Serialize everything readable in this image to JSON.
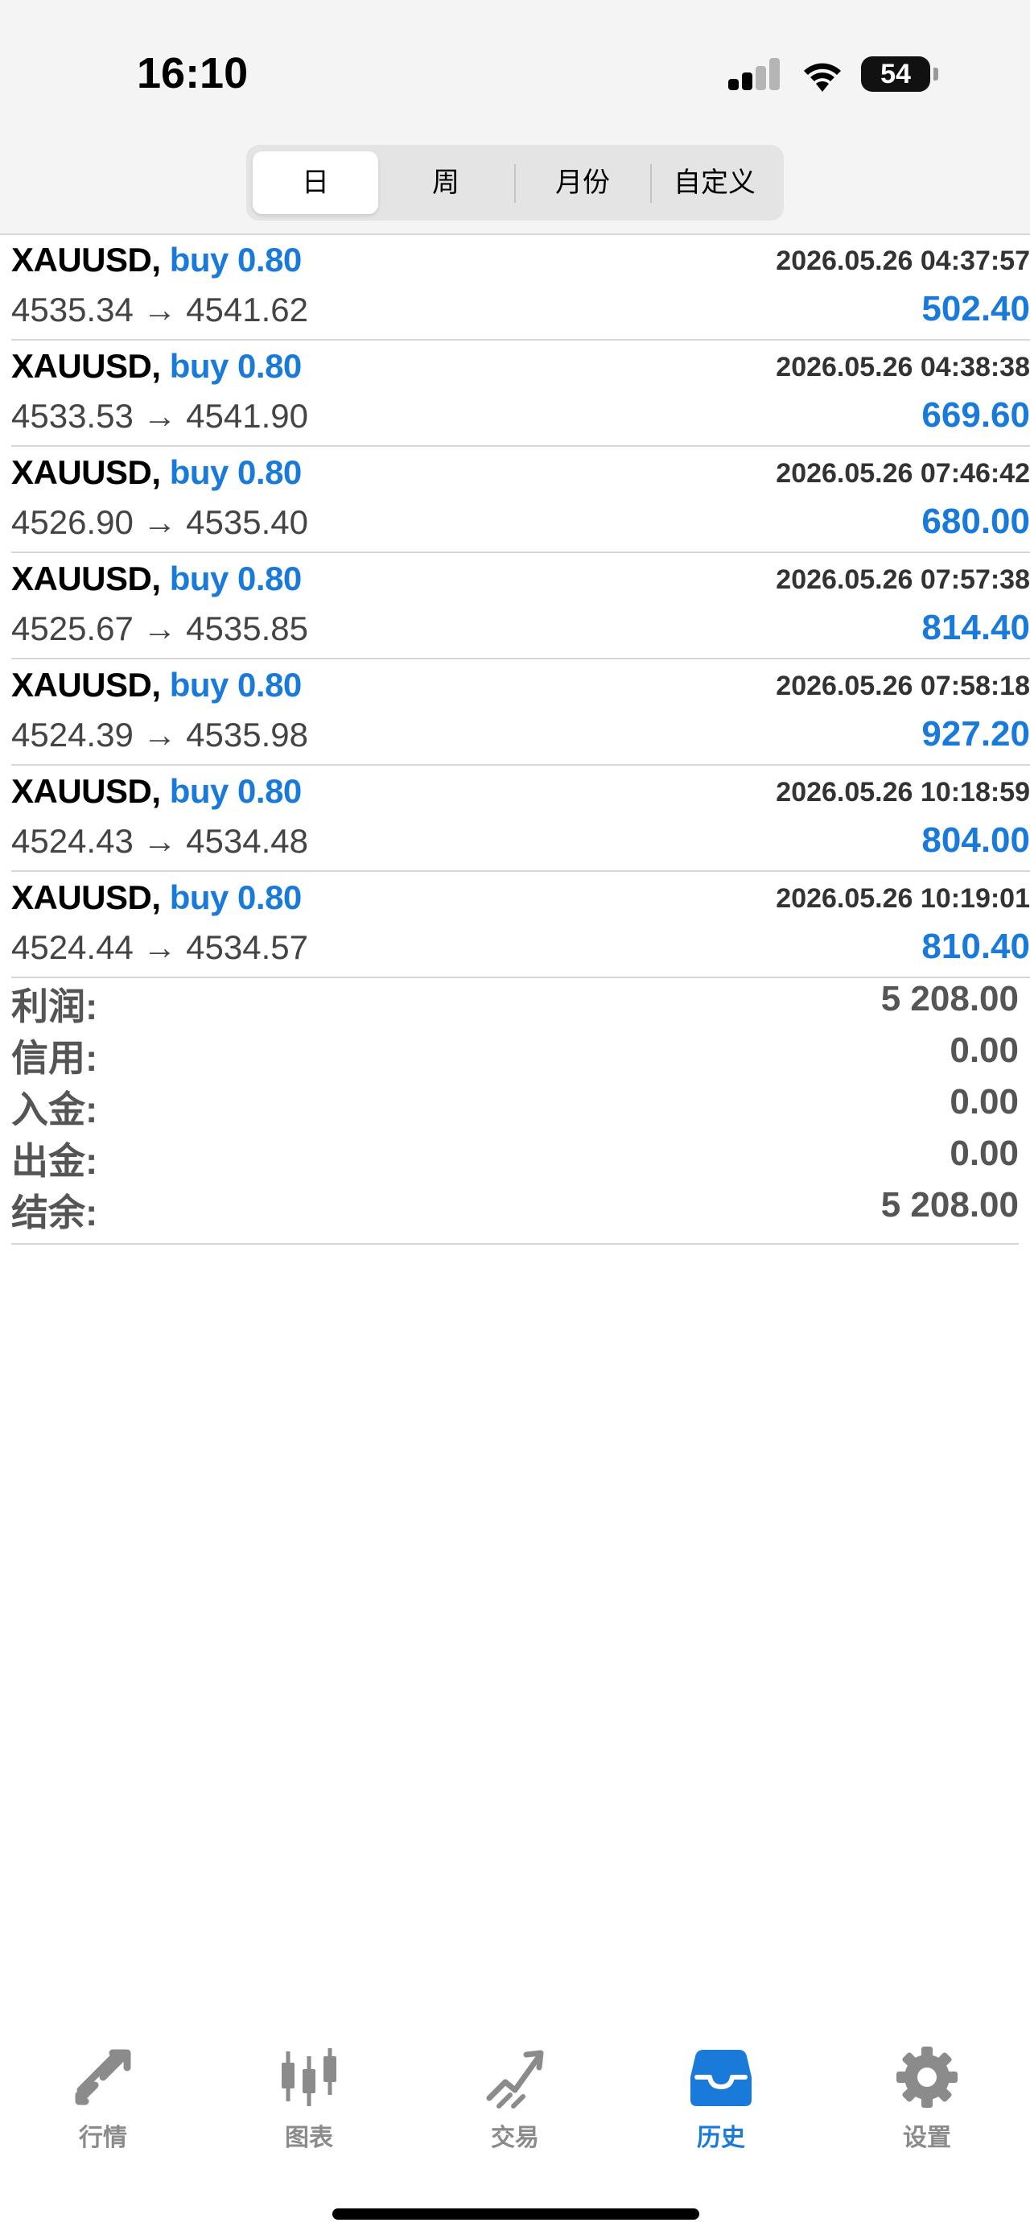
{
  "status_bar": {
    "time": "16:10",
    "battery": "54"
  },
  "period_tabs": [
    {
      "label": "日",
      "active": true
    },
    {
      "label": "周",
      "active": false
    },
    {
      "label": "月份",
      "active": false
    },
    {
      "label": "自定义",
      "active": false
    }
  ],
  "trades": [
    {
      "symbol": "XAUUSD,",
      "side": "buy 0.80",
      "time": "2026.05.26 04:37:57",
      "prices": "4535.34 → 4541.62",
      "profit": "502.40"
    },
    {
      "symbol": "XAUUSD,",
      "side": "buy 0.80",
      "time": "2026.05.26 04:38:38",
      "prices": "4533.53 → 4541.90",
      "profit": "669.60"
    },
    {
      "symbol": "XAUUSD,",
      "side": "buy 0.80",
      "time": "2026.05.26 07:46:42",
      "prices": "4526.90 → 4535.40",
      "profit": "680.00"
    },
    {
      "symbol": "XAUUSD,",
      "side": "buy 0.80",
      "time": "2026.05.26 07:57:38",
      "prices": "4525.67 → 4535.85",
      "profit": "814.40"
    },
    {
      "symbol": "XAUUSD,",
      "side": "buy 0.80",
      "time": "2026.05.26 07:58:18",
      "prices": "4524.39 → 4535.98",
      "profit": "927.20"
    },
    {
      "symbol": "XAUUSD,",
      "side": "buy 0.80",
      "time": "2026.05.26 10:18:59",
      "prices": "4524.43 → 4534.48",
      "profit": "804.00"
    },
    {
      "symbol": "XAUUSD,",
      "side": "buy 0.80",
      "time": "2026.05.26 10:19:01",
      "prices": "4524.44 → 4534.57",
      "profit": "810.40"
    }
  ],
  "summary": [
    {
      "label": "利润:",
      "value": "5 208.00"
    },
    {
      "label": "信用:",
      "value": "0.00"
    },
    {
      "label": "入金:",
      "value": "0.00"
    },
    {
      "label": "出金:",
      "value": "0.00"
    },
    {
      "label": "结余:",
      "value": "5 208.00"
    }
  ],
  "tabbar": [
    {
      "label": "行情",
      "icon": "quotes-arrows-icon",
      "active": false
    },
    {
      "label": "图表",
      "icon": "candlestick-chart-icon",
      "active": false
    },
    {
      "label": "交易",
      "icon": "trade-trend-icon",
      "active": false
    },
    {
      "label": "历史",
      "icon": "history-inbox-icon",
      "active": true
    },
    {
      "label": "设置",
      "icon": "gear-icon",
      "active": false
    }
  ],
  "colors": {
    "accent": "#1a7ad9",
    "inactive": "#8b8b8b",
    "header_bg": "#f4f4f4"
  }
}
